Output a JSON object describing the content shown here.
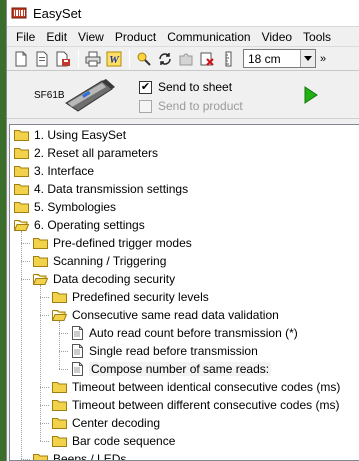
{
  "window": {
    "title": "EasySet"
  },
  "menu": [
    "File",
    "Edit",
    "View",
    "Product",
    "Communication",
    "Video",
    "Tools"
  ],
  "toolbar": {
    "zoom_value": "18 cm",
    "overflow_glyph": "»"
  },
  "device": {
    "model": "SF61B",
    "send_to_sheet": "Send to sheet",
    "send_to_product": "Send to product",
    "send_to_sheet_checked": true,
    "send_to_product_checked": false
  },
  "tree": [
    {
      "label": "1. Using EasySet",
      "level": 0,
      "icon": "folder-closed-icon"
    },
    {
      "label": "2. Reset all parameters",
      "level": 0,
      "icon": "folder-closed-icon"
    },
    {
      "label": "3. Interface",
      "level": 0,
      "icon": "folder-closed-icon"
    },
    {
      "label": "4. Data transmission settings",
      "level": 0,
      "icon": "folder-closed-icon"
    },
    {
      "label": "5. Symbologies",
      "level": 0,
      "icon": "folder-closed-icon"
    },
    {
      "label": "6. Operating settings",
      "level": 0,
      "icon": "folder-open-icon"
    },
    {
      "label": "Pre-defined trigger modes",
      "level": 1,
      "icon": "folder-closed-icon"
    },
    {
      "label": "Scanning / Triggering",
      "level": 1,
      "icon": "folder-closed-icon"
    },
    {
      "label": "Data decoding security",
      "level": 1,
      "icon": "folder-open-icon"
    },
    {
      "label": "Predefined security levels",
      "level": 2,
      "icon": "folder-closed-icon"
    },
    {
      "label": "Consecutive same read data validation",
      "level": 2,
      "icon": "folder-open-icon"
    },
    {
      "label": "Auto read count before transmission (*)",
      "level": 3,
      "icon": "document-icon"
    },
    {
      "label": "Single read before transmission",
      "level": 3,
      "icon": "document-icon"
    },
    {
      "label": "Compose number of same reads:",
      "level": 3,
      "icon": "document-icon",
      "selected": true
    },
    {
      "label": "Timeout between identical consecutive codes (ms)",
      "level": 2,
      "icon": "folder-closed-icon"
    },
    {
      "label": "Timeout between different consecutive codes (ms)",
      "level": 2,
      "icon": "folder-closed-icon"
    },
    {
      "label": "Center decoding",
      "level": 2,
      "icon": "folder-closed-icon"
    },
    {
      "label": "Bar code sequence",
      "level": 2,
      "icon": "folder-closed-icon"
    },
    {
      "label": "Beeps / LEDs",
      "level": 1,
      "icon": "folder-closed-icon"
    }
  ],
  "colors": {
    "folder": "#f2d24a",
    "folder_edge": "#a07f10",
    "play": "#22b014"
  }
}
